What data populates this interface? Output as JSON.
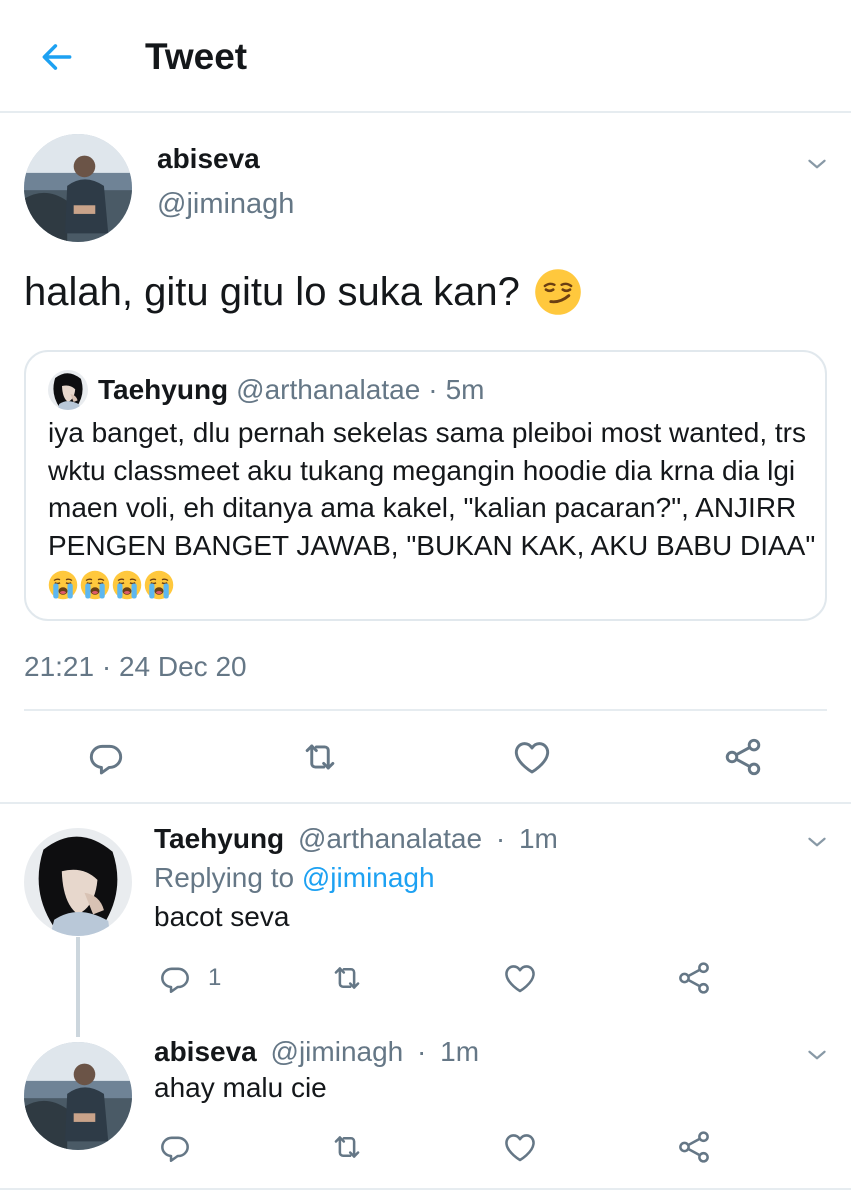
{
  "header": {
    "title": "Tweet",
    "back_icon": "arrow-left-icon",
    "accent": "#1da1f2"
  },
  "main_tweet": {
    "name": "abiseva",
    "handle": "@jiminagh",
    "text": "halah, gitu gitu lo suka kan?",
    "emoji": "smirking-face-emoji",
    "quote": {
      "name": "Taehyung",
      "handle": "@arthanalatae",
      "time": "5m",
      "text": "iya banget, dlu pernah sekelas sama pleiboi most wanted, trs wktu classmeet aku tukang megangin hoodie dia krna dia lgi maen voli, eh ditanya ama kakel, \"kalian pacaran?\", ANJIRR PENGEN BANGET JAWAB, \"BUKAN KAK, AKU BABU DIAA\"",
      "emoji": "loudly-crying-face-emoji"
    },
    "timestamp": "21:21 · 24 Dec 20"
  },
  "replies": [
    {
      "name": "Taehyung",
      "handle": "@arthanalatae",
      "time": "1m",
      "replying_label": "Replying to",
      "replying_to": "@jiminagh",
      "text": "bacot seva",
      "reply_count": "1"
    },
    {
      "name": "abiseva",
      "handle": "@jiminagh",
      "time": "1m",
      "text": "ahay malu cie"
    }
  ],
  "colors": {
    "text": "#14171a",
    "secondary": "#657786",
    "border": "#e6ecf0",
    "link": "#1da1f2"
  }
}
